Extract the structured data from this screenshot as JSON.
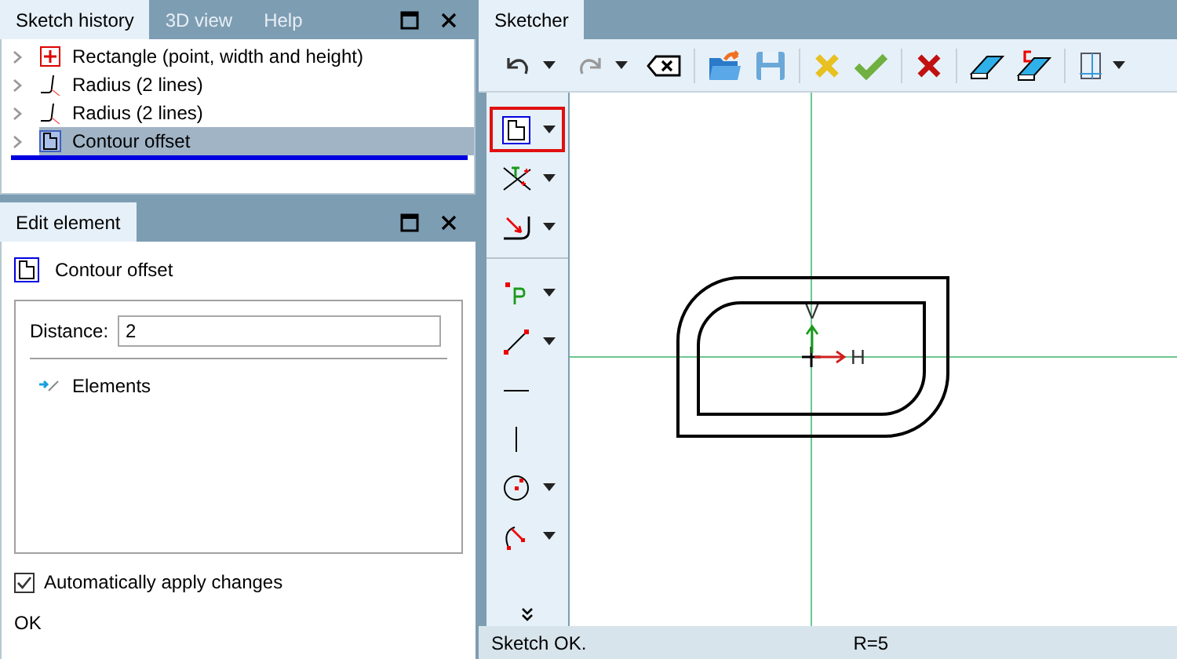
{
  "left_tabs": [
    {
      "label": "Sketch history",
      "selected": true
    },
    {
      "label": "3D view",
      "selected": false
    },
    {
      "label": "Help",
      "selected": false
    }
  ],
  "history": [
    {
      "label": "Rectangle (point, width and height)",
      "kind": "rectangle",
      "selected": false
    },
    {
      "label": "Radius (2 lines)",
      "kind": "radius",
      "selected": false
    },
    {
      "label": "Radius (2 lines)",
      "kind": "radius",
      "selected": false
    },
    {
      "label": "Contour offset",
      "kind": "offset",
      "selected": true
    }
  ],
  "edit_panel": {
    "title": "Edit element",
    "element": "Contour offset",
    "distance_label": "Distance:",
    "distance_value": "2",
    "elements_label": "Elements",
    "auto_apply": {
      "label": "Automatically apply changes",
      "checked": true
    },
    "ok": "OK"
  },
  "sketcher_tab": {
    "label": "Sketcher",
    "selected": true
  },
  "side_tools": [
    {
      "kind": "offset",
      "selected": true,
      "dropdown": true
    },
    {
      "kind": "trim",
      "selected": false,
      "dropdown": true
    },
    {
      "kind": "fillet",
      "selected": false,
      "dropdown": true
    },
    {
      "kind": "point",
      "selected": false,
      "dropdown": true
    },
    {
      "kind": "line",
      "selected": false,
      "dropdown": true
    },
    {
      "kind": "hline",
      "selected": false,
      "dropdown": false
    },
    {
      "kind": "vline",
      "selected": false,
      "dropdown": false
    },
    {
      "kind": "circle",
      "selected": false,
      "dropdown": true
    },
    {
      "kind": "arc",
      "selected": false,
      "dropdown": true
    }
  ],
  "canvas": {
    "axis_v": "V",
    "axis_h": "H"
  },
  "status": {
    "message": "Sketch OK.",
    "reading": "R=5"
  }
}
